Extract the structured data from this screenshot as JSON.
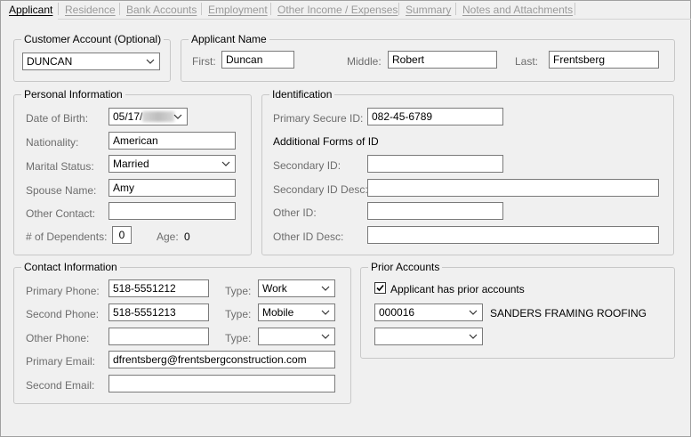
{
  "tabs": [
    {
      "label": "Applicant",
      "active": true
    },
    {
      "label": "Residence",
      "active": false
    },
    {
      "label": "Bank Accounts",
      "active": false
    },
    {
      "label": "Employment",
      "active": false
    },
    {
      "label": "Other Income / Expenses",
      "active": false
    },
    {
      "label": "Summary",
      "active": false
    },
    {
      "label": "Notes and Attachments",
      "active": false
    }
  ],
  "customer_account": {
    "legend": "Customer Account (Optional)",
    "value": "DUNCAN"
  },
  "applicant_name": {
    "legend": "Applicant Name",
    "first_label": "First:",
    "first": "Duncan",
    "middle_label": "Middle:",
    "middle": "Robert",
    "last_label": "Last:",
    "last": "Frentsberg"
  },
  "personal": {
    "legend": "Personal Information",
    "dob_label": "Date of Birth:",
    "dob_visible": "05/17/",
    "nationality_label": "Nationality:",
    "nationality": "American",
    "marital_label": "Marital Status:",
    "marital": "Married",
    "spouse_label": "Spouse Name:",
    "spouse": "Amy",
    "other_contact_label": "Other Contact:",
    "other_contact": "",
    "dependents_label": "# of Dependents:",
    "dependents": "0",
    "age_label": "Age:",
    "age": "0"
  },
  "identification": {
    "legend": "Identification",
    "primary_label": "Primary Secure ID:",
    "primary": "082-45-6789",
    "additional_heading": "Additional Forms of ID",
    "secondary_label": "Secondary ID:",
    "secondary": "",
    "secondary_desc_label": "Secondary ID Desc:",
    "secondary_desc": "",
    "other_id_label": "Other ID:",
    "other_id": "",
    "other_desc_label": "Other ID Desc:",
    "other_desc": ""
  },
  "contact": {
    "legend": "Contact Information",
    "primary_phone_label": "Primary Phone:",
    "primary_phone": "518-5551212",
    "second_phone_label": "Second Phone:",
    "second_phone": "518-5551213",
    "other_phone_label": "Other Phone:",
    "other_phone": "",
    "type_label": "Type:",
    "type1": "Work",
    "type2": "Mobile",
    "type3": "",
    "primary_email_label": "Primary Email:",
    "primary_email": "dfrentsberg@frentsbergconstruction.com",
    "second_email_label": "Second Email:",
    "second_email": ""
  },
  "prior": {
    "legend": "Prior Accounts",
    "checkbox_label": "Applicant has prior accounts",
    "checked": true,
    "account1": "000016",
    "account1_name": "SANDERS FRAMING  ROOFING",
    "account2": ""
  }
}
